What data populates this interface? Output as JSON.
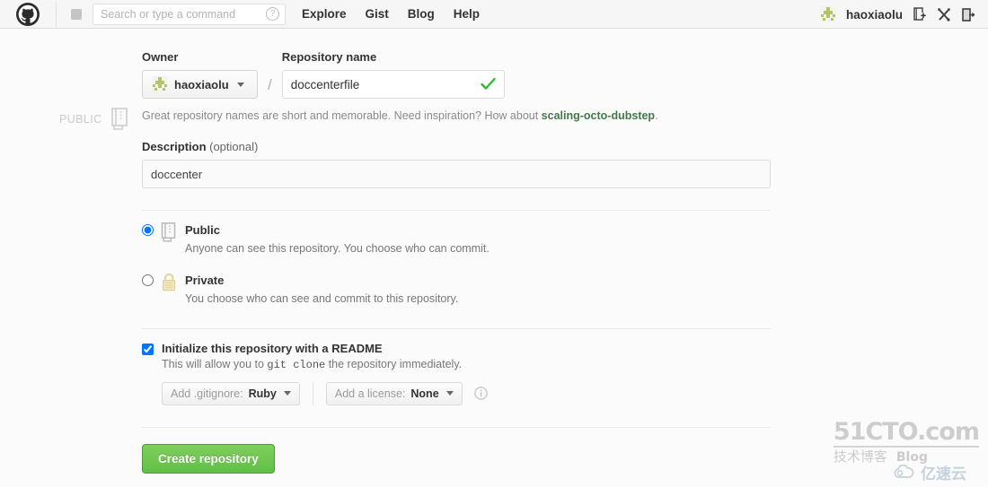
{
  "header": {
    "logo_icon": "github-octocat-icon",
    "dashboard_icon": "dashboard-icon",
    "search": {
      "placeholder": "Search or type a command",
      "value": "",
      "help_icon": "question-circle-icon"
    },
    "nav": [
      {
        "label": "Explore",
        "name": "nav-explore"
      },
      {
        "label": "Gist",
        "name": "nav-gist"
      },
      {
        "label": "Blog",
        "name": "nav-blog"
      },
      {
        "label": "Help",
        "name": "nav-help"
      }
    ],
    "user": {
      "name": "haoxiaolu",
      "avatar_icon": "user-avatar-identicon"
    },
    "actions": [
      {
        "name": "create-new-repo-icon",
        "icon": "repo-create-icon"
      },
      {
        "name": "account-tools-icon",
        "icon": "wrench-screwdriver-icon"
      },
      {
        "name": "sign-out-icon",
        "icon": "logout-door-icon"
      }
    ]
  },
  "visibility_badge": {
    "label": "PUBLIC",
    "icon": "repo-book-icon"
  },
  "form": {
    "owner_label": "Owner",
    "owner_value": "haoxiaolu",
    "owner_caret_icon": "chevron-down-icon",
    "separator": "/",
    "repo_name_label": "Repository name",
    "repo_name_value": "doccenterfile",
    "repo_name_placeholder": "",
    "valid_icon": "green-check-icon",
    "hint_prefix": "Great repository names are short and memorable. Need inspiration? How about ",
    "hint_suggestion": "scaling-octo-dubstep",
    "hint_suffix": ".",
    "description_label": "Description",
    "description_optional": " (optional)",
    "description_value": "doccenter",
    "description_placeholder": "",
    "visibility_options": [
      {
        "title": "Public",
        "desc": "Anyone can see this repository. You choose who can commit.",
        "icon": "repo-book-icon",
        "selected": true
      },
      {
        "title": "Private",
        "desc": "You choose who can see and commit to this repository.",
        "icon": "lock-icon",
        "selected": false
      }
    ],
    "readme": {
      "title": "Initialize this repository with a README",
      "desc_before": "This will allow you to ",
      "desc_code": "git clone",
      "desc_after": " the repository immediately.",
      "checked": true
    },
    "gitignore": {
      "prefix": "Add .gitignore:",
      "value": "Ruby",
      "caret_icon": "chevron-down-icon"
    },
    "license": {
      "prefix": "Add a license:",
      "value": "None",
      "caret_icon": "chevron-down-icon",
      "info_icon": "info-circle-icon"
    },
    "submit_label": "Create repository"
  },
  "watermarks": {
    "cto_main": "51CTO.com",
    "cto_sub_cn": "技术博客",
    "cto_sub_en": "Blog",
    "yun_text": "亿速云",
    "yun_icon": "cloud-icon"
  },
  "colors": {
    "accent_green": "#61bf46",
    "check_green": "#2cbe2c",
    "link_green": "#41794b",
    "header_bg": "#f6f6f6",
    "page_bg": "#fbfbfb"
  }
}
